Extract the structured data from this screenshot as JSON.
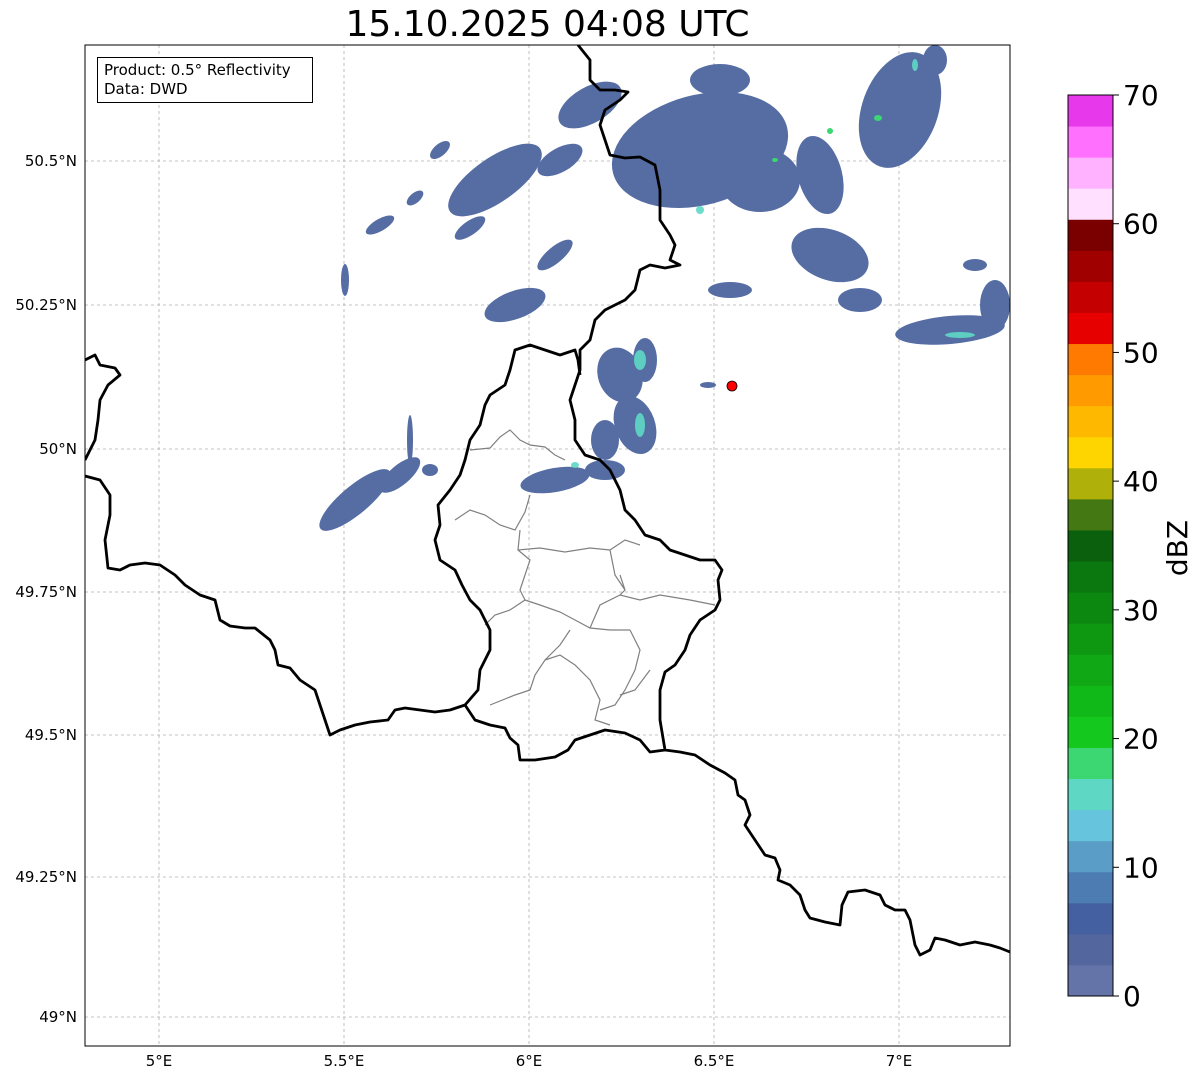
{
  "title": "15.10.2025 04:08 UTC",
  "info": {
    "product": "Product: 0.5° Reflectivity",
    "data": "Data: DWD"
  },
  "axes": {
    "lon_ticks": [
      "5°E",
      "5.5°E",
      "6°E",
      "6.5°E",
      "7°E"
    ],
    "lat_ticks": [
      "50.5°N",
      "50.25°N",
      "50°N",
      "49.75°N",
      "49.5°N",
      "49.25°N",
      "49°N"
    ]
  },
  "colorbar": {
    "unit": "dBZ",
    "tick_labels": [
      "0",
      "10",
      "20",
      "30",
      "40",
      "50",
      "60",
      "70"
    ],
    "colors": [
      "#6574a8",
      "#53669e",
      "#4560a0",
      "#4c7cb2",
      "#5a9ec8",
      "#66c4dc",
      "#5ed8c4",
      "#3cd672",
      "#14c81e",
      "#10b818",
      "#10a814",
      "#0e9812",
      "#0c8810",
      "#0a780e",
      "#0a600c",
      "#447812",
      "#b0b00a",
      "#ffd500",
      "#ffb800",
      "#ff9a00",
      "#ff7a00",
      "#e60000",
      "#c40000",
      "#a00000",
      "#7a0000",
      "#ffe0ff",
      "#ffb2ff",
      "#ff70ff",
      "#e838ec"
    ]
  },
  "radar_marker": {
    "color": "#ff0000"
  }
}
